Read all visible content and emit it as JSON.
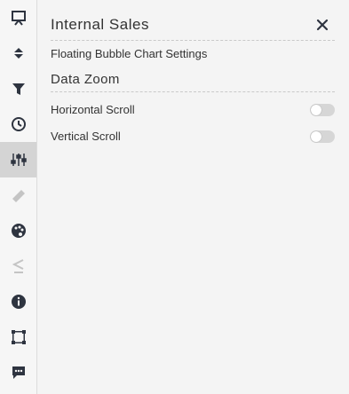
{
  "panel": {
    "title": "Internal Sales",
    "subtitle": "Floating Bubble Chart Settings",
    "section_title": "Data Zoom",
    "settings": [
      {
        "label": "Horizontal Scroll",
        "enabled": false
      },
      {
        "label": "Vertical Scroll",
        "enabled": false
      }
    ]
  },
  "rail": {
    "active_item": "sliders-icon",
    "items": [
      "presentation-icon",
      "sort-arrows-icon",
      "filter-icon",
      "clock-icon",
      "sliders-icon",
      "ruler-icon",
      "palette-icon",
      "less-equal-icon",
      "info-icon",
      "select-frame-icon",
      "comment-icon"
    ]
  },
  "colors": {
    "icon": "#2e3440",
    "icon_disabled": "#c4c4c4",
    "active_bg": "#d4d4d4",
    "toggle_off": "#d6d6d6"
  }
}
